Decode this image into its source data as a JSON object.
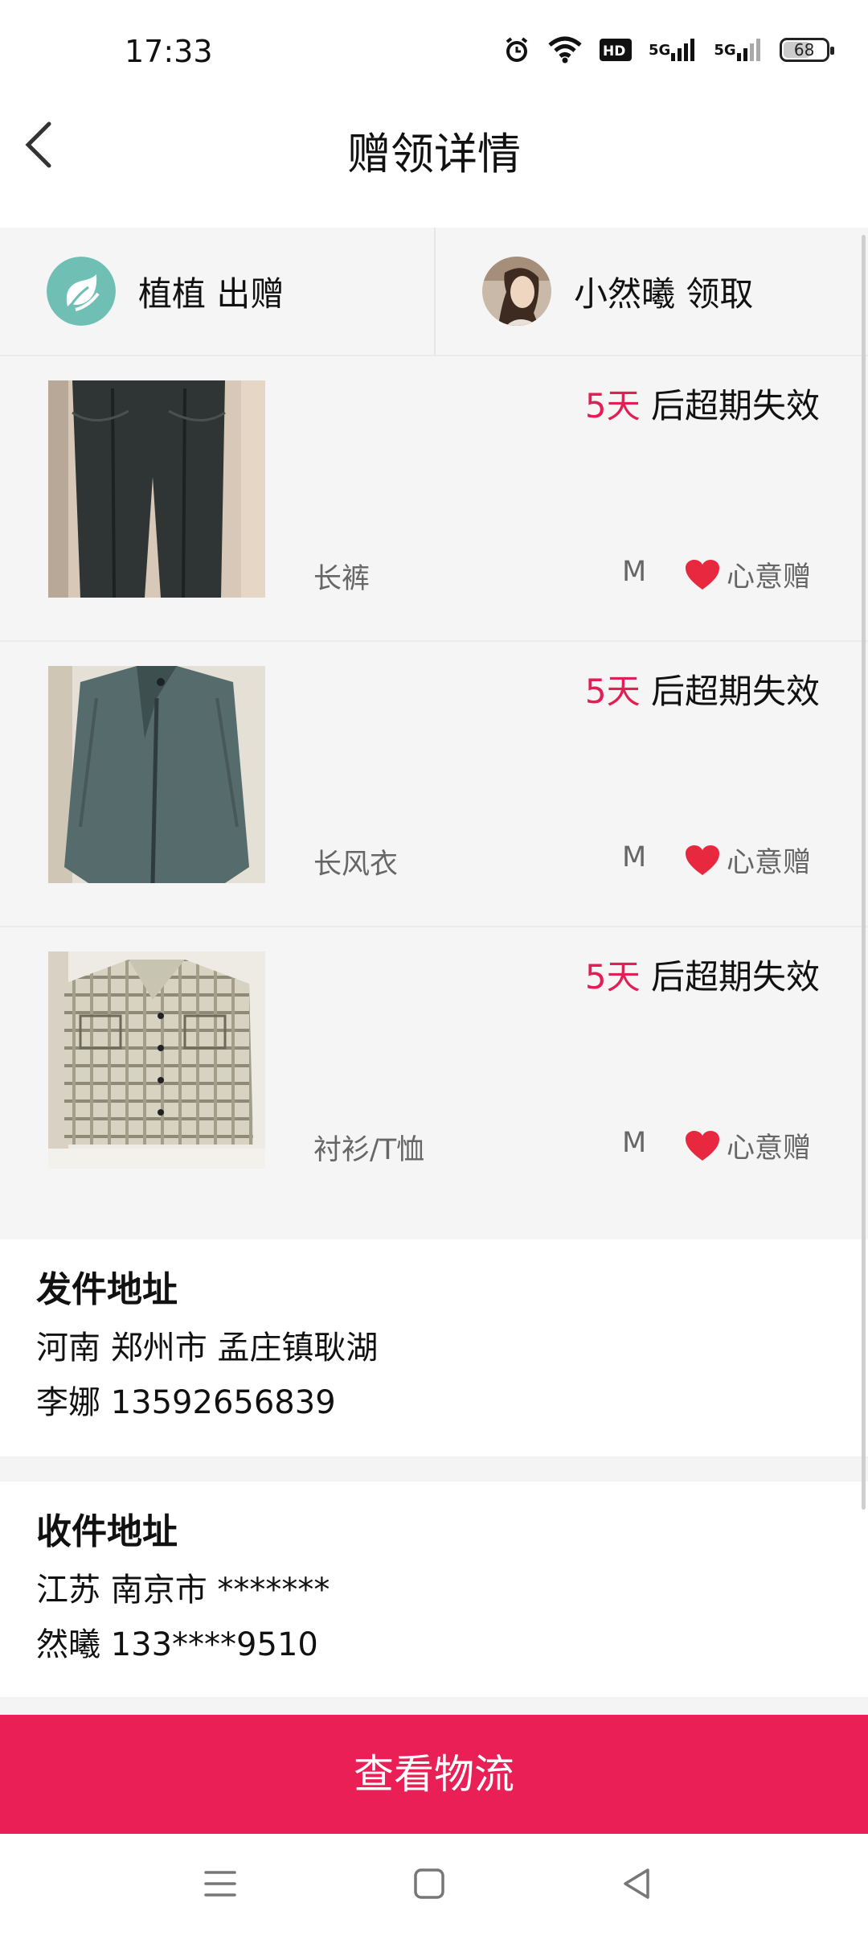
{
  "status_bar": {
    "time": "17:33",
    "battery": "68",
    "net1": "5G",
    "net2": "5G",
    "hd": "HD"
  },
  "header": {
    "title": "赠领详情"
  },
  "giver": {
    "label": "植植 出赠"
  },
  "receiver": {
    "label": "小然曦 领取"
  },
  "items": [
    {
      "days": "5天",
      "expire_text": " 后超期失效",
      "name": "长裤",
      "size": "M",
      "tag": "心意赠"
    },
    {
      "days": "5天",
      "expire_text": " 后超期失效",
      "name": "长风衣",
      "size": "M",
      "tag": "心意赠"
    },
    {
      "days": "5天",
      "expire_text": " 后超期失效",
      "name": "衬衫/T恤",
      "size": "M",
      "tag": "心意赠"
    }
  ],
  "send_address": {
    "title": "发件地址",
    "line1": "河南 郑州市 孟庄镇耿湖",
    "line2": "李娜 13592656839"
  },
  "receive_address": {
    "title": "收件地址",
    "line1": "江苏 南京市 *******",
    "line2": "然曦 133****9510"
  },
  "button": {
    "label": "查看物流"
  },
  "colors": {
    "accent": "#ea1f55",
    "days": "#e21f55",
    "heart": "#e8283f"
  }
}
